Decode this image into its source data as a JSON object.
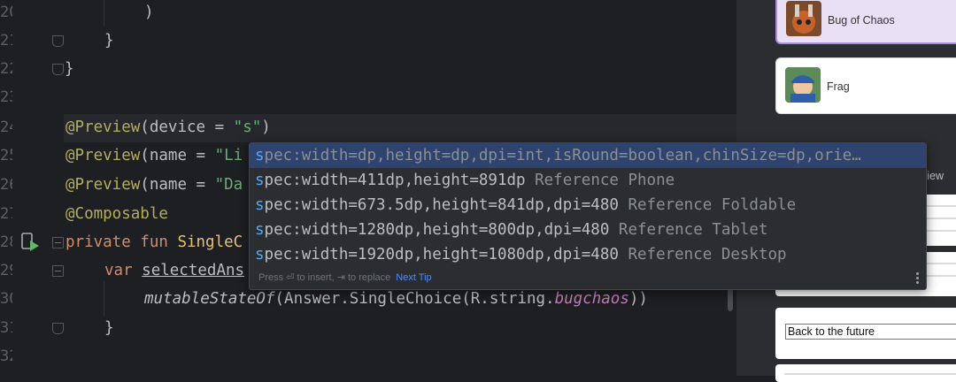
{
  "editor": {
    "line_numbers": [
      "20",
      "21",
      "22",
      "23",
      "24",
      "25",
      "26",
      "27",
      "28",
      "29",
      "30",
      "31",
      "32"
    ],
    "lines": {
      "l20": ")",
      "l21": "}",
      "l22": "}",
      "l24_ann": "@Preview",
      "l24_rest": "(device = ",
      "l24_str": "\"s\"",
      "l24_close": ")",
      "l25_ann": "@Preview",
      "l25_rest": "(name = ",
      "l25_str": "\"Li",
      "l26_ann": "@Preview",
      "l26_rest": "(name = ",
      "l26_str": "\"Da",
      "l27_ann": "@Composable",
      "l28_kw": "private fun ",
      "l28_fn": "SingleC",
      "l29_kw": "var ",
      "l29_id": "selectedAns",
      "l30_fn": "mutableStateOf",
      "l30_rest": "(Answer.SingleChoice(R.string.",
      "l30_res": "bugchaos",
      "l30_close": "))",
      "l31": "}"
    }
  },
  "popup": {
    "items": [
      {
        "match": "s",
        "value": "pec:width=dp,height=dp,dpi=int,isRound=boolean,chinSize=dp,orie…",
        "hint": ""
      },
      {
        "match": "s",
        "value": "pec:width=411dp,height=891dp",
        "hint": "Reference Phone"
      },
      {
        "match": "s",
        "value": "pec:width=673.5dp,height=841dp,dpi=480",
        "hint": "Reference Foldable"
      },
      {
        "match": "s",
        "value": "pec:width=1280dp,height=800dp,dpi=480",
        "hint": "Reference Tablet"
      },
      {
        "match": "s",
        "value": "pec:width=1920dp,height=1080dp,dpi=480",
        "hint": "Reference Desktop"
      }
    ],
    "footer_text": "Press ⏎ to insert, ⇥ to replace",
    "next_tip": "Next Tip"
  },
  "preview": {
    "cards": [
      {
        "label": "Bug of Chaos",
        "icon": "character-avatar-icon"
      },
      {
        "label": "Frag",
        "icon": "character-avatar-icon"
      }
    ],
    "view_label": "view",
    "option_label": "Back to the future"
  },
  "colors": {
    "background": "#1e1f22",
    "annotation": "#b3ae60",
    "keyword": "#cf8e6d",
    "string": "#6aab73",
    "selection": "#2e436e",
    "accent": "#548af7"
  }
}
